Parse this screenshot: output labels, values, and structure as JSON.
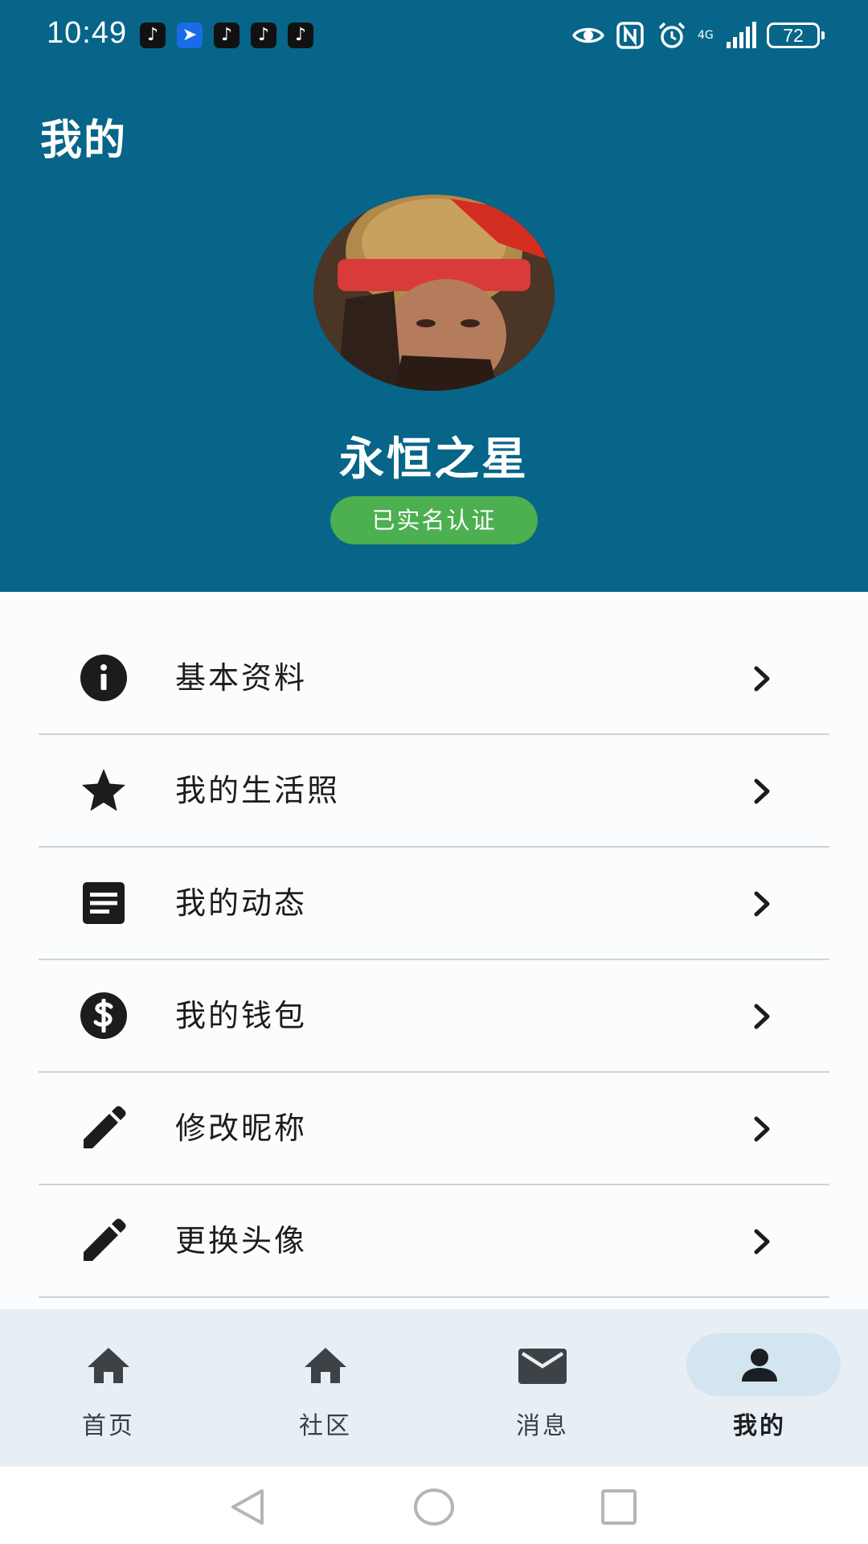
{
  "status_bar": {
    "time": "10:49",
    "network": "4G",
    "battery": "72",
    "notifications": [
      {
        "icon": "tiktok-icon",
        "glyph": "♪"
      },
      {
        "icon": "bird-app-icon",
        "glyph": "➤"
      },
      {
        "icon": "tiktok-icon",
        "glyph": "♪"
      },
      {
        "icon": "tiktok-icon",
        "glyph": "♪"
      },
      {
        "icon": "tiktok-icon",
        "glyph": "♪"
      }
    ]
  },
  "header": {
    "title": "我的",
    "username": "永恒之星",
    "verified_label": "已实名认证"
  },
  "menu": {
    "items": [
      {
        "label": "基本资料",
        "icon": "info-icon"
      },
      {
        "label": "我的生活照",
        "icon": "star-icon"
      },
      {
        "label": "我的动态",
        "icon": "article-icon"
      },
      {
        "label": "我的钱包",
        "icon": "dollar-icon"
      },
      {
        "label": "修改昵称",
        "icon": "pencil-icon"
      },
      {
        "label": "更换头像",
        "icon": "pencil-icon"
      }
    ]
  },
  "bottom_nav": {
    "items": [
      {
        "label": "首页",
        "icon": "home-icon",
        "active": false
      },
      {
        "label": "社区",
        "icon": "home-icon",
        "active": false
      },
      {
        "label": "消息",
        "icon": "mail-icon",
        "active": false
      },
      {
        "label": "我的",
        "icon": "person-icon",
        "active": true
      }
    ]
  },
  "colors": {
    "header_bg": "#066588",
    "badge_bg": "#4caf50",
    "nav_bg": "#e8eff4",
    "nav_active_pill": "#d2e5f1",
    "divider": "#cfd3d6"
  }
}
